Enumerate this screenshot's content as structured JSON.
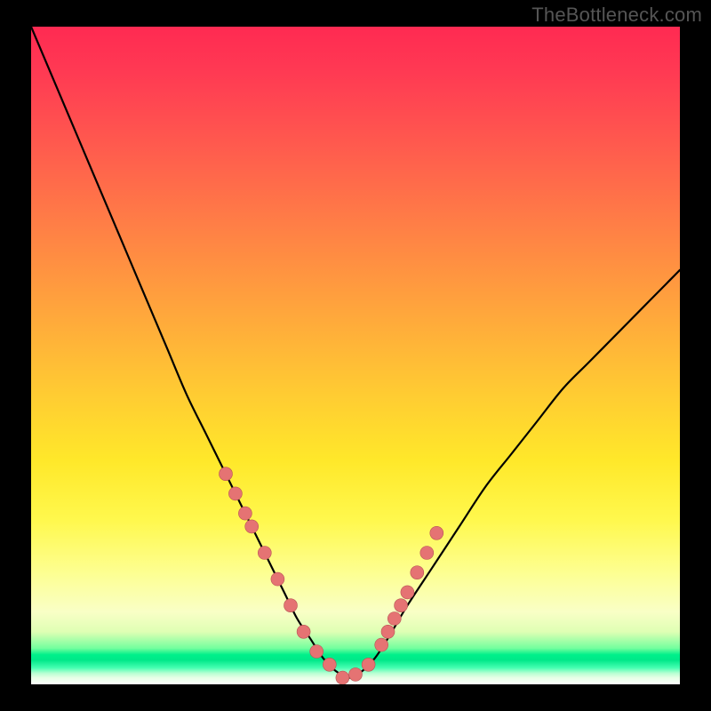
{
  "watermark": "TheBottleneck.com",
  "colors": {
    "frame": "#000000",
    "curve": "#000000",
    "marker_fill": "#e57373",
    "marker_stroke": "#b85555"
  },
  "chart_data": {
    "type": "line",
    "title": "",
    "xlabel": "",
    "ylabel": "",
    "xlim": [
      0,
      100
    ],
    "ylim": [
      0,
      100
    ],
    "series": [
      {
        "name": "bottleneck-curve",
        "x": [
          0,
          3,
          6,
          9,
          12,
          15,
          18,
          21,
          24,
          27,
          30,
          33,
          36,
          39,
          41,
          43,
          45,
          47,
          49,
          51,
          53,
          55,
          58,
          62,
          66,
          70,
          74,
          78,
          82,
          86,
          90,
          94,
          98,
          100
        ],
        "y": [
          100,
          93,
          86,
          79,
          72,
          65,
          58,
          51,
          44,
          38,
          32,
          26,
          20,
          14,
          10,
          7,
          4,
          2,
          1,
          2,
          4,
          7,
          12,
          18,
          24,
          30,
          35,
          40,
          45,
          49,
          53,
          57,
          61,
          63
        ]
      }
    ],
    "markers": {
      "name": "highlighted-points",
      "x": [
        30,
        31.5,
        33,
        34,
        36,
        38,
        40,
        42,
        44,
        46,
        48,
        50,
        52,
        54,
        55,
        56,
        57,
        58,
        59.5,
        61,
        62.5
      ],
      "y": [
        32,
        29,
        26,
        24,
        20,
        16,
        12,
        8,
        5,
        3,
        1,
        1.5,
        3,
        6,
        8,
        10,
        12,
        14,
        17,
        20,
        23
      ]
    }
  }
}
